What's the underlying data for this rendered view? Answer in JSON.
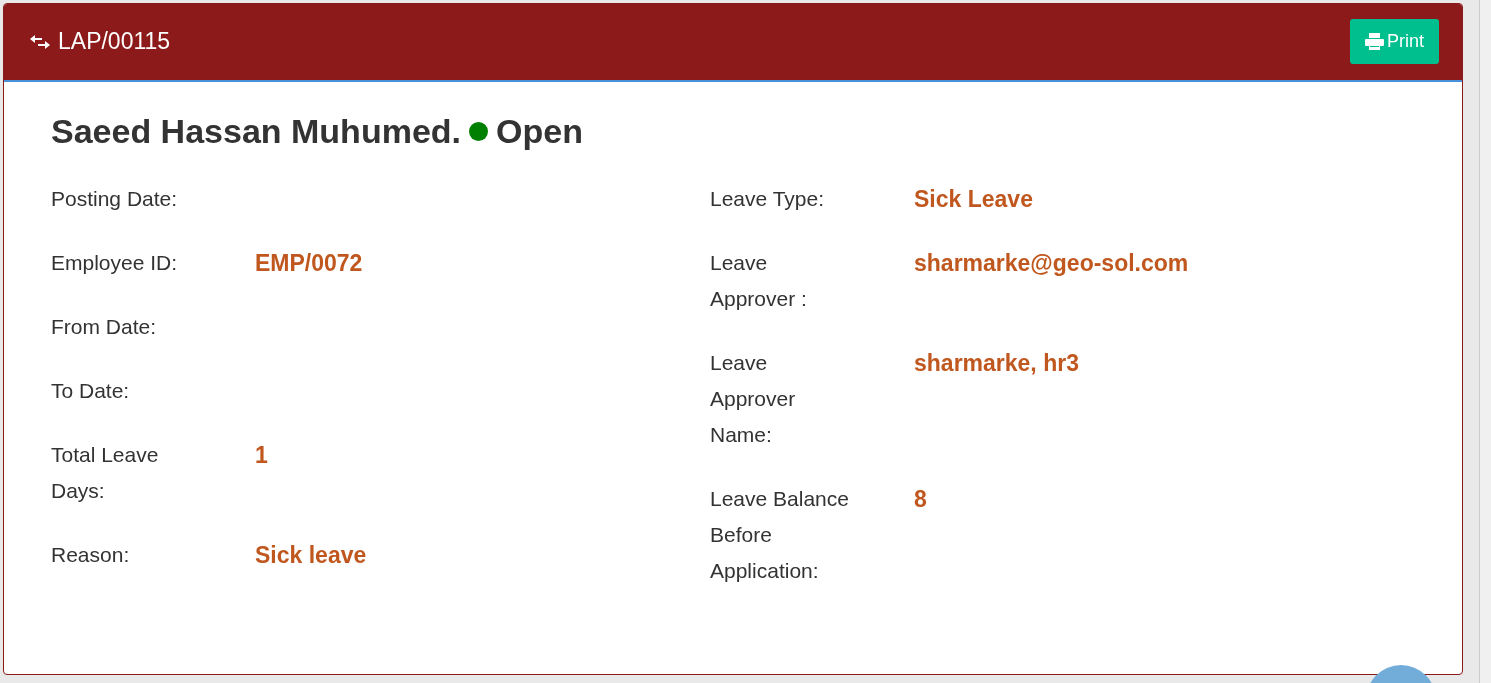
{
  "header": {
    "title": "LAP/00115",
    "print_button": "Print"
  },
  "name": "Saeed Hassan Muhumed.",
  "status": {
    "label": "Open",
    "color": "#008000"
  },
  "left_fields": [
    {
      "label": "Posting Date:"
    },
    {
      "label": "Employee ID:",
      "value": "EMP/0072"
    },
    {
      "label": "From Date:"
    },
    {
      "label": "To Date:"
    },
    {
      "label": "Total Leave Days:",
      "value": "1"
    },
    {
      "label": "Reason:",
      "value": "Sick leave"
    }
  ],
  "right_fields": [
    {
      "label": "Leave Type:",
      "value": "Sick Leave"
    },
    {
      "label": "Leave Approver :",
      "value": "sharmarke@geo-sol.com"
    },
    {
      "label": "Leave Approver Name:",
      "value": "sharmarke, hr3"
    },
    {
      "label": "Leave Balance Before Application:",
      "value": "8"
    }
  ]
}
